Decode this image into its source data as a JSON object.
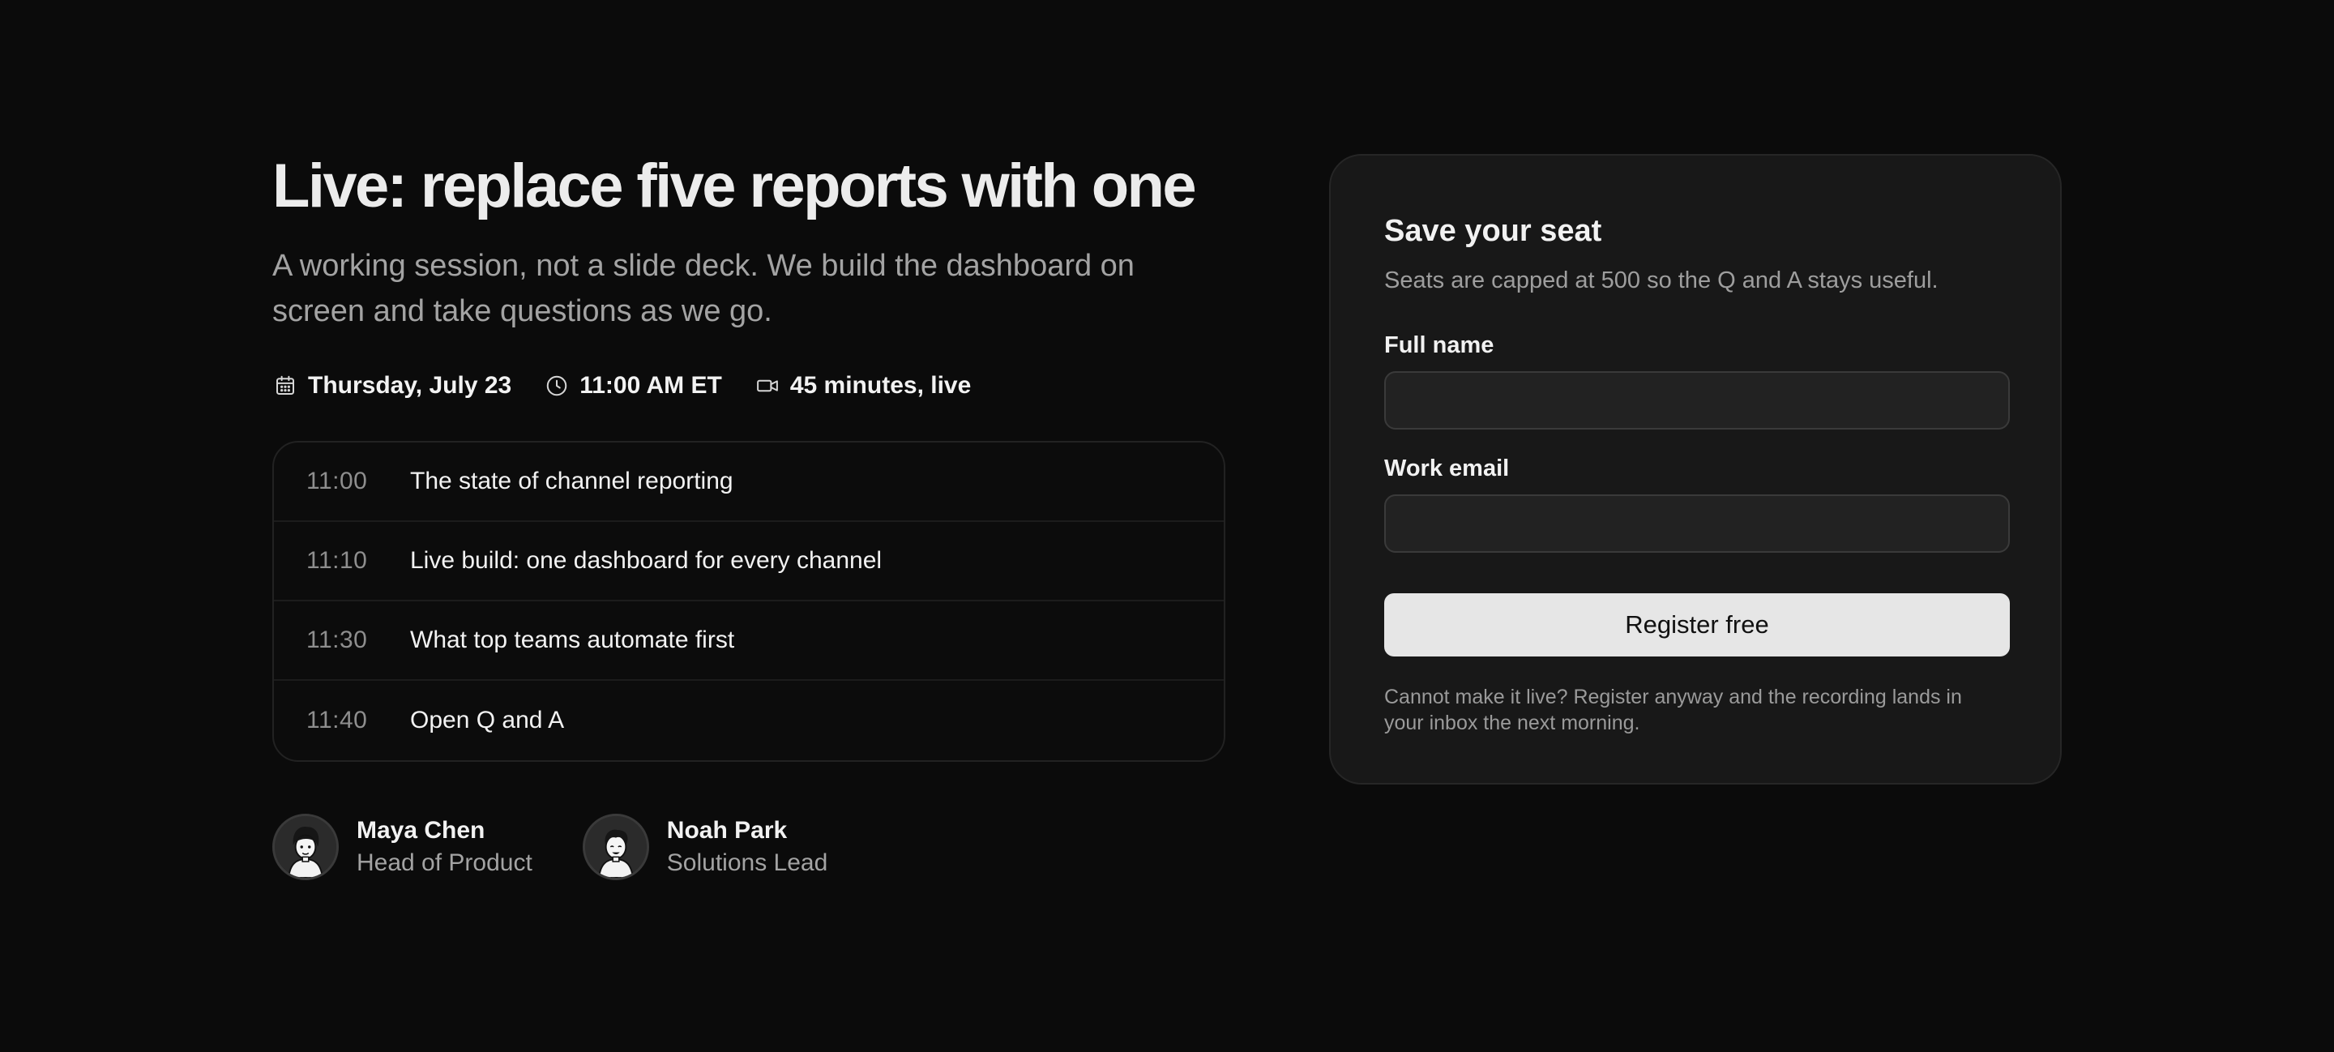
{
  "hero": {
    "title": "Live: replace five reports with one",
    "subtitle": "A working session, not a slide deck. We build the dashboard on screen and take questions as we go."
  },
  "meta": [
    {
      "icon": "calendar-icon",
      "text": "Thursday, July 23"
    },
    {
      "icon": "clock-icon",
      "text": "11:00 AM ET"
    },
    {
      "icon": "video-camera-icon",
      "text": "45 minutes, live"
    }
  ],
  "agenda": [
    {
      "time": "11:00",
      "title": "The state of channel reporting"
    },
    {
      "time": "11:10",
      "title": "Live build: one dashboard for every channel"
    },
    {
      "time": "11:30",
      "title": "What top teams automate first"
    },
    {
      "time": "11:40",
      "title": "Open Q and A"
    }
  ],
  "speakers": [
    {
      "name": "Maya Chen",
      "role": "Head of Product"
    },
    {
      "name": "Noah Park",
      "role": "Solutions Lead"
    }
  ],
  "form": {
    "title": "Save your seat",
    "subtitle": "Seats are capped at 500 so the Q and A stays useful.",
    "full_name_label": "Full name",
    "full_name_value": "",
    "work_email_label": "Work email",
    "work_email_value": "",
    "submit_label": "Register free",
    "note": "Cannot make it live? Register anyway and the recording lands in your inbox the next morning."
  },
  "colors": {
    "background": "#0b0b0b",
    "card": "#181818",
    "button": "#e6e6e6",
    "muted_text": "#a3a3a3"
  }
}
